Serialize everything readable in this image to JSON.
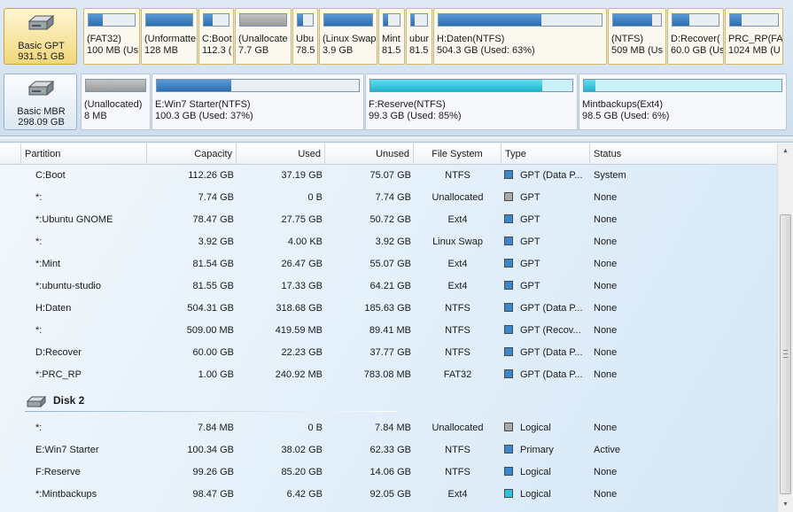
{
  "disk1": {
    "name": "Basic GPT",
    "size": "931.51 GB",
    "partitions": [
      {
        "line1": "(FAT32)",
        "line2": "100 MB (Us",
        "fill": 0.3,
        "color": "blue"
      },
      {
        "line1": "(Unformatte",
        "line2": "128 MB",
        "fill": 1.0,
        "color": "blue"
      },
      {
        "line1": "C:Boot",
        "line2": "112.3 (",
        "fill": 0.35,
        "color": "blue"
      },
      {
        "line1": "(Unallocate",
        "line2": "7.7 GB",
        "fill": 1.0,
        "color": "gray"
      },
      {
        "line1": "Ubu",
        "line2": "78.5",
        "fill": 0.35,
        "color": "blue"
      },
      {
        "line1": "(Linux Swap",
        "line2": "3.9 GB",
        "fill": 1.0,
        "color": "blue"
      },
      {
        "line1": "Mint",
        "line2": "81.5",
        "fill": 0.3,
        "color": "blue"
      },
      {
        "line1": "ubur",
        "line2": "81.5",
        "fill": 0.2,
        "color": "blue"
      },
      {
        "line1": "H:Daten(NTFS)",
        "line2": "504.3 GB (Used: 63%)",
        "fill": 0.63,
        "color": "blue"
      },
      {
        "line1": "(NTFS)",
        "line2": "509 MB (Us",
        "fill": 0.82,
        "color": "blue"
      },
      {
        "line1": "D:Recover(",
        "line2": "60.0 GB (Us",
        "fill": 0.37,
        "color": "blue"
      },
      {
        "line1": "PRC_RP(FA",
        "line2": "1024 MB (U",
        "fill": 0.24,
        "color": "blue"
      }
    ]
  },
  "disk2": {
    "name": "Basic MBR",
    "size": "298.09 GB",
    "partitions": [
      {
        "line1": "(Unallocated)",
        "line2": "8 MB",
        "fill": 1.0,
        "color": "gray"
      },
      {
        "line1": "E:Win7 Starter(NTFS)",
        "line2": "100.3 GB (Used: 37%)",
        "fill": 0.37,
        "color": "blue"
      },
      {
        "line1": "F:Reserve(NTFS)",
        "line2": "99.3 GB (Used: 85%)",
        "fill": 0.85,
        "color": "cyan"
      },
      {
        "line1": "Mintbackups(Ext4)",
        "line2": "98.5 GB (Used: 6%)",
        "fill": 0.06,
        "color": "cyan"
      }
    ]
  },
  "columns": [
    "Partition",
    "Capacity",
    "Used",
    "Unused",
    "File System",
    "Type",
    "Status"
  ],
  "disk1_rows": [
    {
      "partition": "C:Boot",
      "capacity": "112.26 GB",
      "used": "37.19 GB",
      "unused": "75.07 GB",
      "fs": "NTFS",
      "type": "GPT (Data P...",
      "type_color": "#3a86cf",
      "status": "System"
    },
    {
      "partition": "*:",
      "capacity": "7.74 GB",
      "used": "0 B",
      "unused": "7.74 GB",
      "fs": "Unallocated",
      "type": "GPT",
      "type_color": "#a8a8a8",
      "status": "None"
    },
    {
      "partition": "*:Ubuntu GNOME",
      "capacity": "78.47 GB",
      "used": "27.75 GB",
      "unused": "50.72 GB",
      "fs": "Ext4",
      "type": "GPT",
      "type_color": "#3a86cf",
      "status": "None"
    },
    {
      "partition": "*:",
      "capacity": "3.92 GB",
      "used": "4.00 KB",
      "unused": "3.92 GB",
      "fs": "Linux Swap",
      "type": "GPT",
      "type_color": "#3a86cf",
      "status": "None"
    },
    {
      "partition": "*:Mint",
      "capacity": "81.54 GB",
      "used": "26.47 GB",
      "unused": "55.07 GB",
      "fs": "Ext4",
      "type": "GPT",
      "type_color": "#3a86cf",
      "status": "None"
    },
    {
      "partition": "*:ubuntu-studio",
      "capacity": "81.55 GB",
      "used": "17.33 GB",
      "unused": "64.21 GB",
      "fs": "Ext4",
      "type": "GPT",
      "type_color": "#3a86cf",
      "status": "None"
    },
    {
      "partition": "H:Daten",
      "capacity": "504.31 GB",
      "used": "318.68 GB",
      "unused": "185.63 GB",
      "fs": "NTFS",
      "type": "GPT (Data P...",
      "type_color": "#3a86cf",
      "status": "None"
    },
    {
      "partition": "*:",
      "capacity": "509.00 MB",
      "used": "419.59 MB",
      "unused": "89.41 MB",
      "fs": "NTFS",
      "type": "GPT (Recov...",
      "type_color": "#3a86cf",
      "status": "None"
    },
    {
      "partition": "D:Recover",
      "capacity": "60.00 GB",
      "used": "22.23 GB",
      "unused": "37.77 GB",
      "fs": "NTFS",
      "type": "GPT (Data P...",
      "type_color": "#3a86cf",
      "status": "None"
    },
    {
      "partition": "*:PRC_RP",
      "capacity": "1.00 GB",
      "used": "240.92 MB",
      "unused": "783.08 MB",
      "fs": "FAT32",
      "type": "GPT (Data P...",
      "type_color": "#3a86cf",
      "status": "None"
    }
  ],
  "disk2_label": "Disk 2",
  "disk2_rows": [
    {
      "partition": "*:",
      "capacity": "7.84 MB",
      "used": "0 B",
      "unused": "7.84 MB",
      "fs": "Unallocated",
      "type": "Logical",
      "type_color": "#a8a8a8",
      "status": "None"
    },
    {
      "partition": "E:Win7 Starter",
      "capacity": "100.34 GB",
      "used": "38.02 GB",
      "unused": "62.33 GB",
      "fs": "NTFS",
      "type": "Primary",
      "type_color": "#3a86cf",
      "status": "Active"
    },
    {
      "partition": "F:Reserve",
      "capacity": "99.26 GB",
      "used": "85.20 GB",
      "unused": "14.06 GB",
      "fs": "NTFS",
      "type": "Logical",
      "type_color": "#3a86cf",
      "status": "None"
    },
    {
      "partition": "*:Mintbackups",
      "capacity": "98.47 GB",
      "used": "6.42 GB",
      "unused": "92.05 GB",
      "fs": "Ext4",
      "type": "Logical",
      "type_color": "#2fc2de",
      "status": "None"
    }
  ]
}
